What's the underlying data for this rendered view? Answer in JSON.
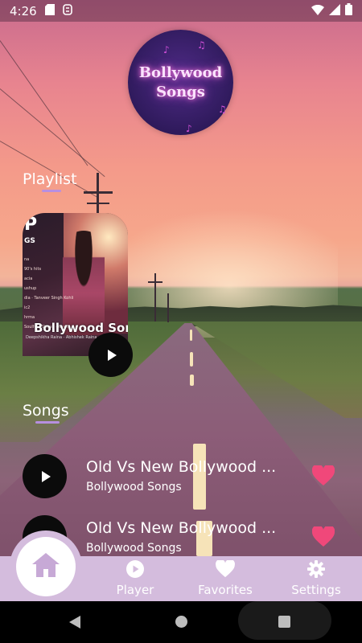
{
  "status_bar": {
    "time": "4:26",
    "icons": [
      "sd-card-icon",
      "sync-icon",
      "wifi-icon",
      "signal-icon",
      "battery-icon"
    ]
  },
  "logo": {
    "line1": "Bollywood",
    "line2": "Songs"
  },
  "playlist_section": {
    "title": "Playlist",
    "card": {
      "overlay_title": "Bollywood Songs",
      "corner_text": "P",
      "corner_sub": "GS",
      "lines": [
        "na",
        "90's hits",
        "acia",
        "ushup",
        "dia · Tanveer Singh Kohli",
        "ic2",
        "hrma",
        "Soulful · Shaan · Kavita"
      ],
      "credit": "Deepshikha Raina · Abhishek Raina"
    }
  },
  "songs_section": {
    "title": "Songs",
    "items": [
      {
        "title": "Old Vs New Bollywood ...",
        "subtitle": "Bollywood Songs",
        "favorite": true
      },
      {
        "title": "Old Vs New Bollywood ...",
        "subtitle": "Bollywood Songs",
        "favorite": true
      }
    ]
  },
  "bottom_nav": {
    "items": [
      {
        "label": "Home",
        "icon": "home-icon",
        "active": true
      },
      {
        "label": "Player",
        "icon": "play-circle-icon",
        "active": false
      },
      {
        "label": "Favorites",
        "icon": "heart-icon",
        "active": false
      },
      {
        "label": "Settings",
        "icon": "gear-icon",
        "active": false
      }
    ]
  },
  "colors": {
    "nav_bg": "#d4bcdd",
    "heart": "#f0487a",
    "accent_underline": "#b78fe0",
    "logo_bg": "#2f1a5c"
  }
}
